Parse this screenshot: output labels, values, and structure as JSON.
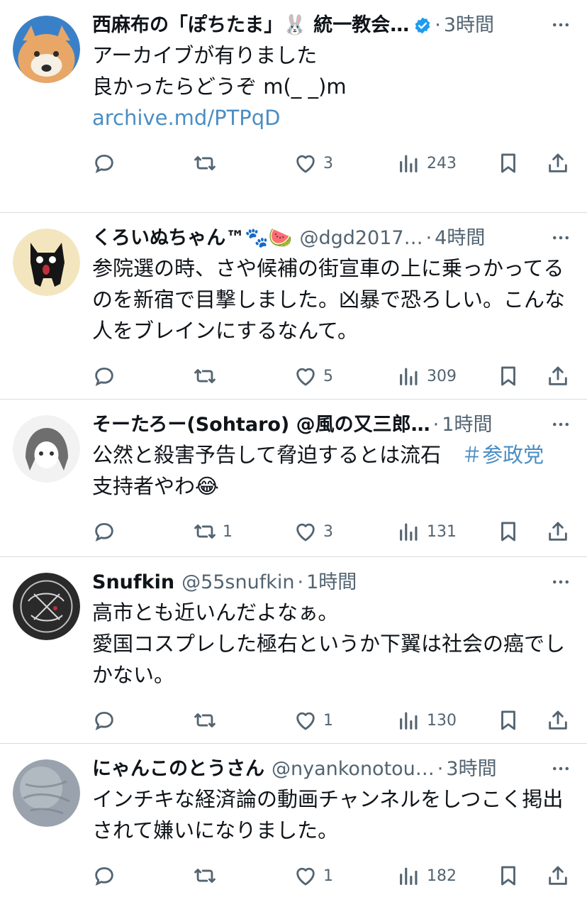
{
  "colors": {
    "text": "#0f1419",
    "muted": "#536471",
    "link": "#4a8ec4",
    "verified": "#1d9bf0",
    "divider": "#d8dde1"
  },
  "tweets": [
    {
      "name": "西麻布の「ぽちたま」🐰 統一教会…",
      "verified": true,
      "handle": "",
      "dot": "·",
      "time": "3時間",
      "text": "アーカイブが有りました\n良かったらどうぞ m(_ _)m\n",
      "link": "archive.md/PTPqD",
      "hashtag": "",
      "text_after": "",
      "replies": "",
      "retweets": "",
      "likes": "3",
      "views": "243"
    },
    {
      "name": "くろいぬちゃん™🐾🍉",
      "verified": false,
      "handle": "@dgd2017…",
      "dot": "·",
      "time": "4時間",
      "text": "参院選の時、さや候補の街宣車の上に乗っかってるのを新宿で目撃しました。凶暴で恐ろしい。こんな人をブレインにするなんて。",
      "link": "",
      "hashtag": "",
      "text_after": "",
      "replies": "",
      "retweets": "",
      "likes": "5",
      "views": "309"
    },
    {
      "name": "そーたろー(Sohtaro) @風の又三郎…",
      "verified": false,
      "handle": "",
      "dot": "·",
      "time": "1時間",
      "text": "公然と殺害予告して脅迫するとは流石　",
      "link": "",
      "hashtag": "＃参政党",
      "text_after": "支持者やわ😂",
      "replies": "",
      "retweets": "1",
      "likes": "3",
      "views": "131"
    },
    {
      "name": "Snufkin",
      "verified": false,
      "handle": "@55snufkin",
      "dot": "·",
      "time": "1時間",
      "text": "高市とも近いんだよなぁ。\n愛国コスプレした極右というか下翼は社会の癌でしかない。",
      "link": "",
      "hashtag": "",
      "text_after": "",
      "replies": "",
      "retweets": "",
      "likes": "1",
      "views": "130"
    },
    {
      "name": "にゃんこのとうさん",
      "verified": false,
      "handle": "@nyankonotou…",
      "dot": "·",
      "time": "3時間",
      "text": "インチキな経済論の動画チャンネルをしつこく掲出されて嫌いになりました。",
      "link": "",
      "hashtag": "",
      "text_after": "",
      "replies": "",
      "retweets": "",
      "likes": "1",
      "views": "182"
    }
  ]
}
